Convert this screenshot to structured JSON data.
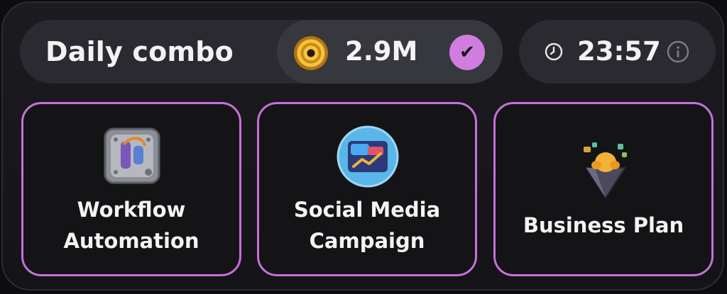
{
  "header": {
    "title": "Daily combo",
    "reward_amount": "2.9M",
    "reward_claimed": true,
    "timer": "23:57"
  },
  "cards": [
    {
      "label_line1": "Workflow",
      "label_line2": "Automation",
      "icon": "workflow-automation-icon"
    },
    {
      "label_line1": "Social Media",
      "label_line2": "Campaign",
      "icon": "social-media-campaign-icon"
    },
    {
      "label_line1": "Business Plan",
      "label_line2": "",
      "icon": "business-plan-icon"
    }
  ],
  "colors": {
    "accent": "#c76fd8",
    "check_badge": "#d17de0",
    "background": "#141418",
    "pill": "#2a2a30"
  }
}
